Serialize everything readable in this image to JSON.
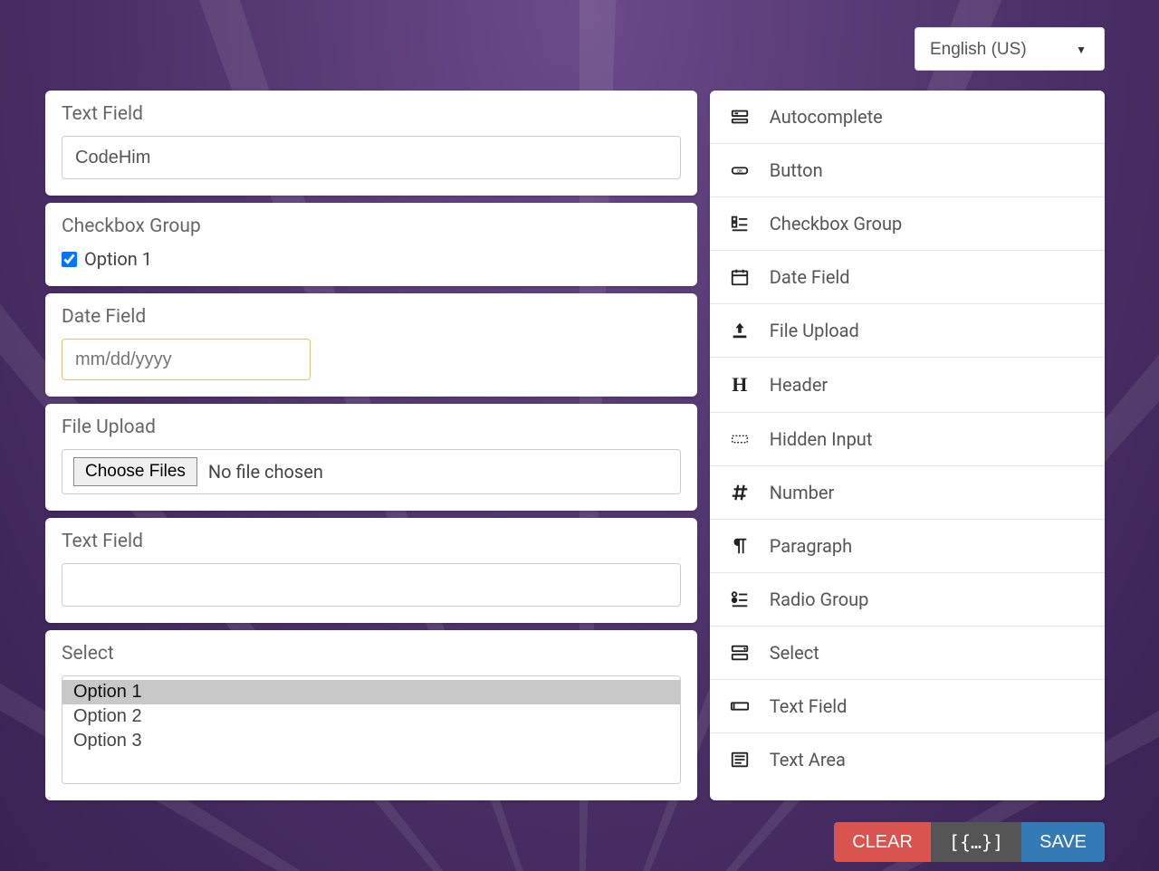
{
  "language": {
    "selected": "English (US)"
  },
  "form": {
    "text1": {
      "label": "Text Field",
      "value": "CodeHim"
    },
    "checkboxGroup": {
      "label": "Checkbox Group",
      "option": "Option 1",
      "checked": true
    },
    "date": {
      "label": "Date Field",
      "placeholder": "mm/dd/yyyy"
    },
    "file": {
      "label": "File Upload",
      "button": "Choose Files",
      "status": "No file chosen"
    },
    "text2": {
      "label": "Text Field",
      "value": ""
    },
    "select": {
      "label": "Select",
      "options": [
        "Option 1",
        "Option 2",
        "Option 3"
      ],
      "selected": "Option 1"
    }
  },
  "palette": [
    "Autocomplete",
    "Button",
    "Checkbox Group",
    "Date Field",
    "File Upload",
    "Header",
    "Hidden Input",
    "Number",
    "Paragraph",
    "Radio Group",
    "Select",
    "Text Field",
    "Text Area"
  ],
  "actions": {
    "clear": "CLEAR",
    "json": "[{…}]",
    "save": "SAVE"
  }
}
